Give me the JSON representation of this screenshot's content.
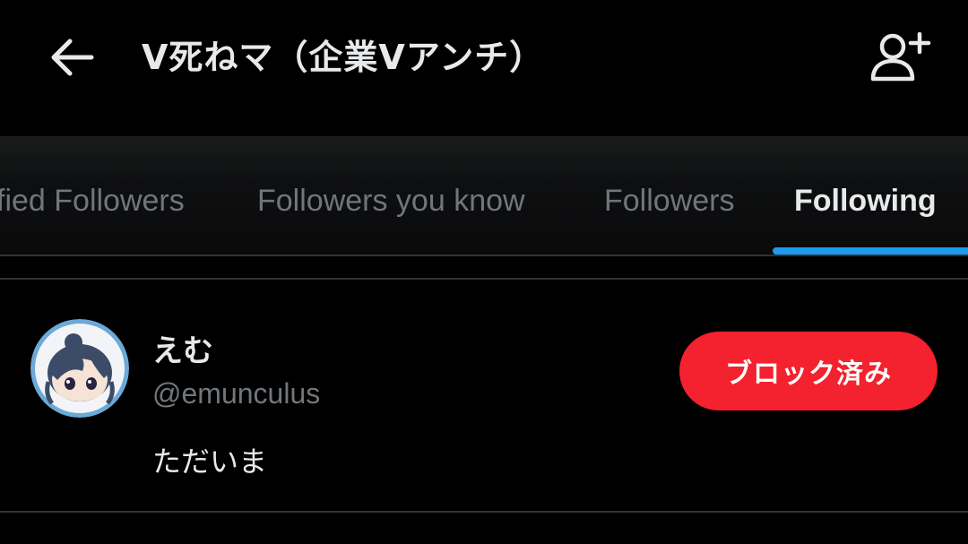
{
  "header": {
    "title": "V死ねマ（企業Vアンチ）",
    "back_icon": "arrow-left-icon",
    "follow_icon": "person-add-icon"
  },
  "tabs": [
    {
      "label": "fied Followers",
      "active": false
    },
    {
      "label": "Followers you know",
      "active": false
    },
    {
      "label": "Followers",
      "active": false
    },
    {
      "label": "Following",
      "active": true
    }
  ],
  "users": [
    {
      "display_name": "えむ",
      "handle": "@emunculus",
      "bio": "ただいま",
      "button_label": "ブロック済み"
    }
  ],
  "colors": {
    "background": "#000000",
    "text_primary": "#e7e9ea",
    "text_secondary": "#71767b",
    "accent": "#1d9bf0",
    "blocked": "#f4212e",
    "divider": "#2f3336"
  }
}
